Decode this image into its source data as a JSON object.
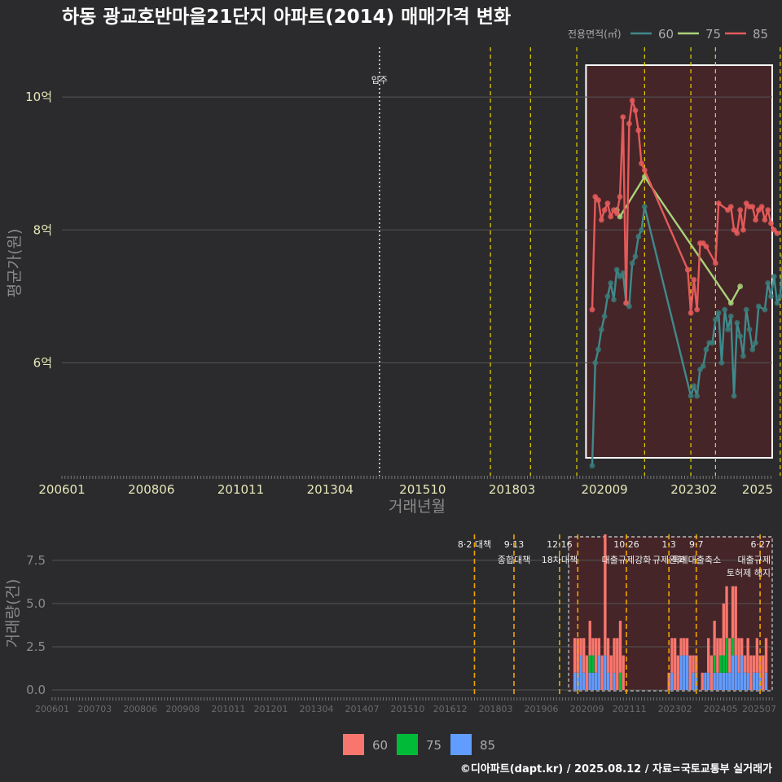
{
  "title": "하동 광교호반마을21단지 아파트(2014) 매매가격 변화",
  "footer": "©디아파트(dapt.kr) / 2025.08.12 / 자료=국토교통부 실거래가",
  "colors": {
    "background": "#2b2b2d",
    "s60": "#3f8a8c",
    "s60_point": "#3b7a78",
    "s75": "#a9d27a",
    "s85": "#e55a5a",
    "bar60": "#f8766d",
    "bar75": "#00ba38",
    "bar85": "#619cff",
    "event_line": "#e8d200",
    "event_line_bottom": "#f0a500",
    "highlight_fill": "#4a2428"
  },
  "chart_data": [
    {
      "type": "line",
      "ylabel": "평균가(원)",
      "xlabel": "거래년월",
      "legend": {
        "title": "전용면적(㎡)",
        "position": "top-right",
        "entries": [
          "60",
          "75",
          "85"
        ]
      },
      "x_ticks": [
        "200601",
        "200806",
        "201011",
        "201304",
        "201510",
        "201803",
        "202009",
        "202302",
        "2025"
      ],
      "y_ticks": [
        {
          "value": 6,
          "label": "6억"
        },
        {
          "value": 8,
          "label": "8억"
        },
        {
          "value": 10,
          "label": "10억"
        }
      ],
      "ylim": [
        4.3,
        10.75
      ],
      "move_in": {
        "date": "2014.08",
        "label": "입주"
      },
      "event_lines": [
        "2017.08",
        "2018.09",
        "2019.12",
        "2021.10",
        "2023.01",
        "2023.09",
        "2025.06",
        "2025.07"
      ],
      "highlight": {
        "start": "2020.03",
        "end": "2025.12"
      },
      "grid": true,
      "series": [
        {
          "name": "60",
          "points": [
            [
              "2020.05",
              4.45
            ],
            [
              "2020.06",
              6.0
            ],
            [
              "2020.07",
              6.2
            ],
            [
              "2020.08",
              6.5
            ],
            [
              "2020.09",
              6.7
            ],
            [
              "2020.10",
              7.0
            ],
            [
              "2020.11",
              7.2
            ],
            [
              "2020.12",
              6.95
            ],
            [
              "2021.01",
              7.4
            ],
            [
              "2021.02",
              7.3
            ],
            [
              "2021.03",
              7.35
            ],
            [
              "2021.04",
              6.9
            ],
            [
              "2021.05",
              6.85
            ],
            [
              "2021.06",
              7.5
            ],
            [
              "2021.07",
              7.6
            ],
            [
              "2021.08",
              7.9
            ],
            [
              "2021.09",
              8.0
            ],
            [
              "2021.10",
              8.35
            ],
            [
              "2023.01",
              5.5
            ],
            [
              "2023.02",
              5.65
            ],
            [
              "2023.03",
              5.5
            ],
            [
              "2023.04",
              5.9
            ],
            [
              "2023.05",
              5.95
            ],
            [
              "2023.06",
              6.2
            ],
            [
              "2023.07",
              6.3
            ],
            [
              "2023.08",
              6.3
            ],
            [
              "2023.09",
              6.65
            ],
            [
              "2023.10",
              6.75
            ],
            [
              "2023.11",
              6.0
            ],
            [
              "2023.12",
              6.8
            ],
            [
              "2024.01",
              6.5
            ],
            [
              "2024.02",
              6.7
            ],
            [
              "2024.03",
              5.5
            ],
            [
              "2024.04",
              6.6
            ],
            [
              "2024.05",
              6.4
            ],
            [
              "2024.06",
              6.1
            ],
            [
              "2024.07",
              6.8
            ],
            [
              "2024.08",
              6.5
            ],
            [
              "2024.09",
              6.2
            ],
            [
              "2024.10",
              6.3
            ],
            [
              "2024.11",
              6.85
            ],
            [
              "2025.01",
              6.8
            ],
            [
              "2025.02",
              7.2
            ],
            [
              "2025.03",
              7.0
            ],
            [
              "2025.04",
              7.3
            ],
            [
              "2025.05",
              6.9
            ],
            [
              "2025.06",
              7.0
            ],
            [
              "2025.07",
              7.6
            ],
            [
              "2025.08",
              6.8
            ]
          ]
        },
        {
          "name": "75",
          "points": [
            [
              "2021.01",
              8.3
            ],
            [
              "2021.02",
              8.2
            ],
            [
              "2021.10",
              8.8
            ],
            [
              "2024.02",
              6.9
            ],
            [
              "2024.05",
              7.15
            ]
          ]
        },
        {
          "name": "85",
          "points": [
            [
              "2020.05",
              6.8
            ],
            [
              "2020.06",
              8.5
            ],
            [
              "2020.07",
              8.45
            ],
            [
              "2020.08",
              8.15
            ],
            [
              "2020.09",
              8.3
            ],
            [
              "2020.10",
              8.4
            ],
            [
              "2020.11",
              8.2
            ],
            [
              "2020.12",
              8.3
            ],
            [
              "2021.01",
              8.25
            ],
            [
              "2021.02",
              8.5
            ],
            [
              "2021.03",
              9.7
            ],
            [
              "2021.04",
              6.9
            ],
            [
              "2021.05",
              9.6
            ],
            [
              "2021.06",
              9.95
            ],
            [
              "2021.07",
              9.8
            ],
            [
              "2021.08",
              9.5
            ],
            [
              "2021.09",
              9.0
            ],
            [
              "2021.10",
              8.9
            ],
            [
              "2022.12",
              7.4
            ],
            [
              "2023.01",
              6.75
            ],
            [
              "2023.02",
              7.25
            ],
            [
              "2023.03",
              6.8
            ],
            [
              "2023.04",
              7.8
            ],
            [
              "2023.05",
              7.8
            ],
            [
              "2023.06",
              7.75
            ],
            [
              "2023.09",
              7.5
            ],
            [
              "2023.10",
              8.4
            ],
            [
              "2024.01",
              8.3
            ],
            [
              "2024.02",
              8.35
            ],
            [
              "2024.03",
              8.0
            ],
            [
              "2024.04",
              7.95
            ],
            [
              "2024.05",
              8.3
            ],
            [
              "2024.06",
              8.0
            ],
            [
              "2024.07",
              8.4
            ],
            [
              "2024.08",
              8.35
            ],
            [
              "2024.09",
              8.35
            ],
            [
              "2024.10",
              8.15
            ],
            [
              "2024.11",
              8.3
            ],
            [
              "2024.12",
              8.35
            ],
            [
              "2025.01",
              8.15
            ],
            [
              "2025.02",
              8.3
            ],
            [
              "2025.03",
              8.1
            ],
            [
              "2025.04",
              8.0
            ],
            [
              "2025.05",
              7.95
            ]
          ]
        }
      ]
    },
    {
      "type": "bar",
      "stacked": true,
      "ylabel": "거래량(건)",
      "y_ticks": [
        0,
        2.5,
        5.0,
        7.5
      ],
      "y_tick_labels": [
        "0.0",
        "2.5",
        "5.0",
        "7.5"
      ],
      "ylim": [
        0,
        9.0
      ],
      "x_ticks": [
        "200601",
        "200703",
        "200806",
        "200908",
        "201011",
        "201201",
        "201304",
        "201407",
        "201510",
        "201612",
        "201803",
        "201906",
        "202009",
        "202111",
        "202302",
        "202405",
        "202507"
      ],
      "legend": {
        "position": "bottom",
        "entries": [
          "60",
          "75",
          "85"
        ]
      },
      "highlight": {
        "start": "2020.03",
        "end": "2025.12"
      },
      "events": [
        {
          "date": "2017.08",
          "lines": [
            "8·2 대책"
          ]
        },
        {
          "date": "2018.09",
          "lines": [
            "9·13",
            "종합대책"
          ]
        },
        {
          "date": "2019.12",
          "lines": [
            "12·16",
            "18차대책"
          ]
        },
        {
          "date": "2020.06",
          "lines": [
            ""
          ]
        },
        {
          "date": "2021.10",
          "lines": [
            "10·26",
            "대출규제강화"
          ]
        },
        {
          "date": "2022.12",
          "lines": [
            "1·3",
            "규제완화"
          ]
        },
        {
          "date": "2023.09",
          "lines": [
            "9·7",
            "특례대출축소"
          ]
        },
        {
          "date": "2025.06",
          "lines": [
            "6·27",
            "대출규제"
          ]
        }
      ],
      "extra_labels": [
        "토허제 해지"
      ],
      "bars": [
        {
          "date": "2020.05",
          "s60": 2,
          "s75": 0,
          "s85": 1
        },
        {
          "date": "2020.06",
          "s60": 2,
          "s75": 0,
          "s85": 1
        },
        {
          "date": "2020.07",
          "s60": 1,
          "s75": 0,
          "s85": 2
        },
        {
          "date": "2020.08",
          "s60": 2,
          "s75": 0,
          "s85": 1
        },
        {
          "date": "2020.09",
          "s60": 2,
          "s75": 0,
          "s85": 0
        },
        {
          "date": "2020.10",
          "s60": 2,
          "s75": 1,
          "s85": 1
        },
        {
          "date": "2020.11",
          "s60": 1,
          "s75": 1,
          "s85": 1
        },
        {
          "date": "2020.12",
          "s60": 2,
          "s75": 0,
          "s85": 1
        },
        {
          "date": "2021.01",
          "s60": 1,
          "s75": 0,
          "s85": 2
        },
        {
          "date": "2021.02",
          "s60": 2,
          "s75": 0,
          "s85": 0
        },
        {
          "date": "2021.03",
          "s60": 7,
          "s75": 0,
          "s85": 2
        },
        {
          "date": "2021.04",
          "s60": 2,
          "s75": 0,
          "s85": 1
        },
        {
          "date": "2021.05",
          "s60": 2,
          "s75": 0,
          "s85": 0
        },
        {
          "date": "2021.06",
          "s60": 2,
          "s75": 0,
          "s85": 1
        },
        {
          "date": "2021.07",
          "s60": 3,
          "s75": 0,
          "s85": 0
        },
        {
          "date": "2021.08",
          "s60": 3,
          "s75": 1,
          "s85": 0
        },
        {
          "date": "2021.09",
          "s60": 2,
          "s75": 0,
          "s85": 0
        },
        {
          "date": "2022.12",
          "s60": 1,
          "s75": 0,
          "s85": 0
        },
        {
          "date": "2023.01",
          "s60": 2,
          "s75": 0,
          "s85": 1
        },
        {
          "date": "2023.02",
          "s60": 3,
          "s75": 0,
          "s85": 0
        },
        {
          "date": "2023.03",
          "s60": 2,
          "s75": 0,
          "s85": 0
        },
        {
          "date": "2023.04",
          "s60": 1,
          "s75": 0,
          "s85": 2
        },
        {
          "date": "2023.05",
          "s60": 1,
          "s75": 0,
          "s85": 2
        },
        {
          "date": "2023.06",
          "s60": 1,
          "s75": 0,
          "s85": 2
        },
        {
          "date": "2023.07",
          "s60": 2,
          "s75": 0,
          "s85": 0
        },
        {
          "date": "2023.08",
          "s60": 1,
          "s75": 0,
          "s85": 1
        },
        {
          "date": "2023.09",
          "s60": 1,
          "s75": 0,
          "s85": 1
        },
        {
          "date": "2023.11",
          "s60": 1,
          "s75": 0,
          "s85": 0
        },
        {
          "date": "2023.12",
          "s60": 0,
          "s75": 0,
          "s85": 1
        },
        {
          "date": "2024.01",
          "s60": 2,
          "s75": 0,
          "s85": 1
        },
        {
          "date": "2024.02",
          "s60": 2,
          "s75": 0,
          "s85": 0
        },
        {
          "date": "2024.03",
          "s60": 2,
          "s75": 1,
          "s85": 1
        },
        {
          "date": "2024.04",
          "s60": 2,
          "s75": 0,
          "s85": 1
        },
        {
          "date": "2024.05",
          "s60": 1,
          "s75": 1,
          "s85": 1
        },
        {
          "date": "2024.06",
          "s60": 3,
          "s75": 1,
          "s85": 1
        },
        {
          "date": "2024.07",
          "s60": 3,
          "s75": 2,
          "s85": 1
        },
        {
          "date": "2024.08",
          "s60": 2,
          "s75": 0,
          "s85": 1
        },
        {
          "date": "2024.09",
          "s60": 3,
          "s75": 1,
          "s85": 2
        },
        {
          "date": "2024.10",
          "s60": 4,
          "s75": 0,
          "s85": 2
        },
        {
          "date": "2024.11",
          "s60": 2,
          "s75": 0,
          "s85": 1
        },
        {
          "date": "2024.12",
          "s60": 1,
          "s75": 0,
          "s85": 2
        },
        {
          "date": "2025.01",
          "s60": 1,
          "s75": 0,
          "s85": 1
        },
        {
          "date": "2025.02",
          "s60": 2,
          "s75": 0,
          "s85": 1
        },
        {
          "date": "2025.03",
          "s60": 2,
          "s75": 0,
          "s85": 0
        },
        {
          "date": "2025.04",
          "s60": 1,
          "s75": 0,
          "s85": 1
        },
        {
          "date": "2025.05",
          "s60": 2,
          "s75": 0,
          "s85": 1
        },
        {
          "date": "2025.06",
          "s60": 1,
          "s75": 0,
          "s85": 1
        },
        {
          "date": "2025.07",
          "s60": 2,
          "s75": 0,
          "s85": 0
        },
        {
          "date": "2025.08",
          "s60": 2,
          "s75": 0,
          "s85": 1
        }
      ]
    }
  ]
}
